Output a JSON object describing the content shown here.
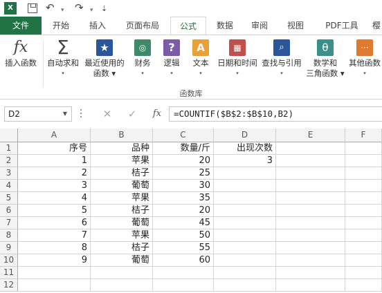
{
  "qat": {
    "app_icon": "excel-icon",
    "undo_glyph": "↶",
    "redo_glyph": "↷",
    "more_glyph": "⇣"
  },
  "tabs": [
    "文件",
    "开始",
    "插入",
    "页面布局",
    "公式",
    "数据",
    "审阅",
    "视图",
    "PDF工具",
    "樱"
  ],
  "active_tab": "公式",
  "ribbon": {
    "buttons": [
      {
        "line1": "插入函数",
        "line2": "",
        "icon": "fx-icon"
      },
      {
        "line1": "自动求和",
        "line2": "▾",
        "icon": "sigma-icon"
      },
      {
        "line1": "最近使用的",
        "line2": "函数 ▾",
        "icon": "star-book-icon"
      },
      {
        "line1": "财务",
        "line2": "▾",
        "icon": "coins-book-icon"
      },
      {
        "line1": "逻辑",
        "line2": "▾",
        "icon": "question-book-icon"
      },
      {
        "line1": "文本",
        "line2": "▾",
        "icon": "text-book-icon"
      },
      {
        "line1": "日期和时间",
        "line2": "▾",
        "icon": "calendar-book-icon"
      },
      {
        "line1": "查找与引用",
        "line2": "▾",
        "icon": "search-book-icon"
      },
      {
        "line1": "数学和",
        "line2": "三角函数 ▾",
        "icon": "theta-book-icon"
      },
      {
        "line1": "其他函数",
        "line2": "▾",
        "icon": "more-book-icon"
      }
    ],
    "group_label": "函数库",
    "colors": {
      "blue": "#2b579a",
      "green": "#3c8a68",
      "purple": "#7b5ca8",
      "orange": "#e8a03b",
      "red": "#c0504d",
      "teal": "#3a8f8a"
    }
  },
  "formula_bar": {
    "name_box": "D2",
    "cancel_glyph": "✕",
    "enter_glyph": "✓",
    "fx_label": "fx",
    "formula": "=COUNTIF($B$2:$B$10,B2)"
  },
  "sheet": {
    "columns": [
      "A",
      "B",
      "C",
      "D",
      "E",
      "F"
    ],
    "rows": [
      {
        "num": "1",
        "cells": [
          "序号",
          "品种",
          "数量/斤",
          "出现次数",
          "",
          ""
        ]
      },
      {
        "num": "2",
        "cells": [
          "1",
          "苹果",
          "20",
          "3",
          "",
          ""
        ]
      },
      {
        "num": "3",
        "cells": [
          "2",
          "桔子",
          "25",
          "",
          "",
          ""
        ]
      },
      {
        "num": "4",
        "cells": [
          "3",
          "葡萄",
          "30",
          "",
          "",
          ""
        ]
      },
      {
        "num": "5",
        "cells": [
          "4",
          "苹果",
          "35",
          "",
          "",
          ""
        ]
      },
      {
        "num": "6",
        "cells": [
          "5",
          "桔子",
          "20",
          "",
          "",
          ""
        ]
      },
      {
        "num": "7",
        "cells": [
          "6",
          "葡萄",
          "45",
          "",
          "",
          ""
        ]
      },
      {
        "num": "8",
        "cells": [
          "7",
          "苹果",
          "50",
          "",
          "",
          ""
        ]
      },
      {
        "num": "9",
        "cells": [
          "8",
          "桔子",
          "55",
          "",
          "",
          ""
        ]
      },
      {
        "num": "10",
        "cells": [
          "9",
          "葡萄",
          "60",
          "",
          "",
          ""
        ]
      },
      {
        "num": "11",
        "cells": [
          "",
          "",
          "",
          "",
          "",
          ""
        ]
      },
      {
        "num": "12",
        "cells": [
          "",
          "",
          "",
          "",
          "",
          ""
        ]
      }
    ]
  },
  "theme": {
    "accent": "#217346",
    "grid_line": "#d4d4d4",
    "header_bg": "#f3f3f3"
  }
}
